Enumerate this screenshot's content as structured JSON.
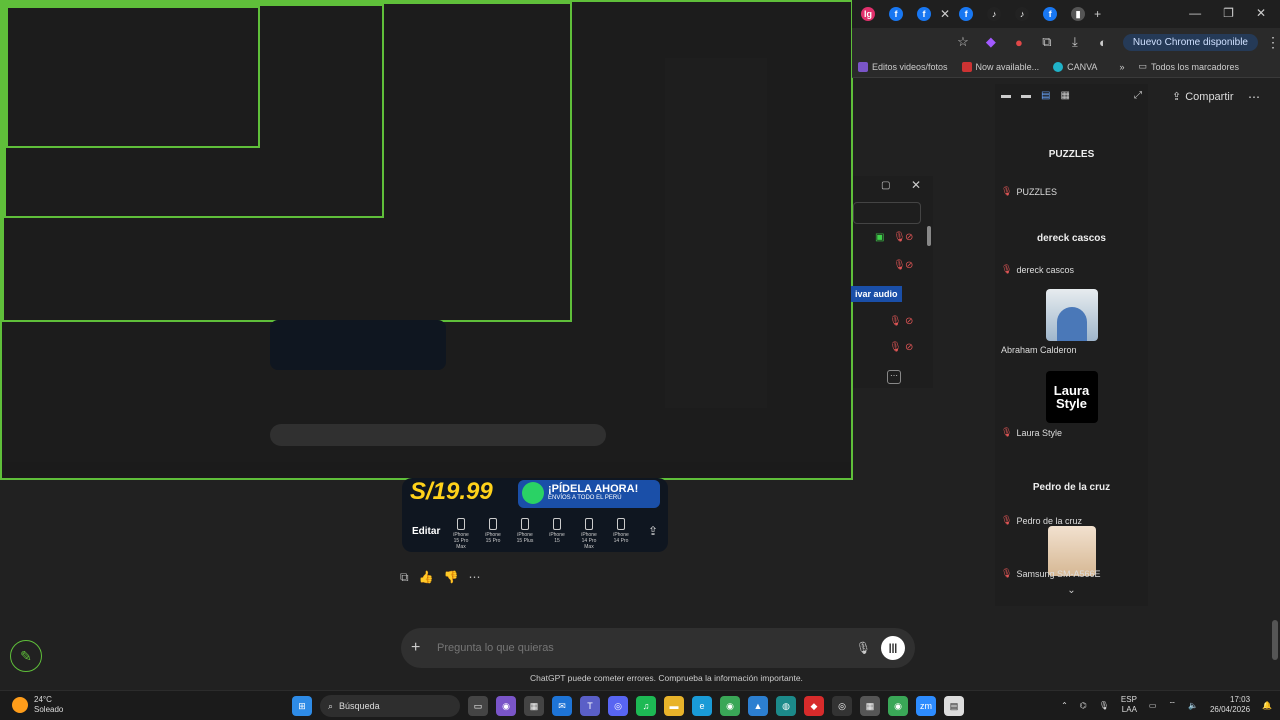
{
  "chrome": {
    "tabs": [
      {
        "icon": "instagram-icon",
        "color": "#e1306c",
        "label": "Ig"
      },
      {
        "icon": "facebook-icon",
        "color": "#1877f2",
        "label": "f"
      },
      {
        "icon": "facebook-icon",
        "color": "#1877f2",
        "label": "f"
      },
      {
        "icon": "facebook-icon",
        "color": "#1877f2",
        "label": "f"
      },
      {
        "icon": "tiktok-icon",
        "color": "#222222",
        "label": "♪"
      },
      {
        "icon": "tiktok-icon",
        "color": "#222222",
        "label": "♪"
      },
      {
        "icon": "facebook-icon",
        "color": "#1877f2",
        "label": "f"
      },
      {
        "icon": "generic-icon",
        "color": "#555555",
        "label": "▮"
      }
    ],
    "update_label": "Nuevo Chrome disponible",
    "bookmarks": [
      {
        "label": "Editos videos/fotos",
        "color": "#7a55c8"
      },
      {
        "label": "Now available...",
        "color": "#cc3333"
      },
      {
        "label": "CANVA",
        "color": "#20b2c8"
      }
    ],
    "all_bookmarks": "Todos los marcadores"
  },
  "meet": {
    "share_label": "Compartir",
    "title": "PUZZLES",
    "participants": [
      {
        "name": "PUZZLES",
        "type": "text-tile",
        "tile_title": "dereck cascos"
      },
      {
        "name": "dereck cascos",
        "type": "photo"
      },
      {
        "name": "Abraham Calderon",
        "type": "logo",
        "logo_text": "Laura Style"
      },
      {
        "name": "Laura Style",
        "type": "text-tile",
        "tile_title": "Pedro de la cruz"
      },
      {
        "name": "Pedro de la cruz",
        "type": "photo"
      },
      {
        "name": "Samsung SM-A566E",
        "type": "none"
      }
    ],
    "activate_audio": "ivar audio"
  },
  "promo": {
    "price": "S/19.99",
    "whatsapp_headline": "¡PÍDELA AHORA!",
    "whatsapp_sub": "ENVÍOS A TODO EL PERÚ",
    "edit_label": "Editar",
    "models": [
      "iPhone 15 Pro Max",
      "iPhone 15 Pro",
      "iPhone 15 Plus",
      "iPhone 15",
      "iPhone 14 Pro Max",
      "iPhone 14 Pro"
    ]
  },
  "chat": {
    "placeholder": "Pregunta lo que quieras",
    "disclaimer": "ChatGPT puede cometer errores. Comprueba la información importante."
  },
  "taskbar": {
    "temperature": "24°C",
    "weather": "Soleado",
    "search_label": "Búsqueda",
    "lang": "ESP",
    "lang2": "LAA",
    "time": "17:03",
    "date": "26/04/2026"
  }
}
